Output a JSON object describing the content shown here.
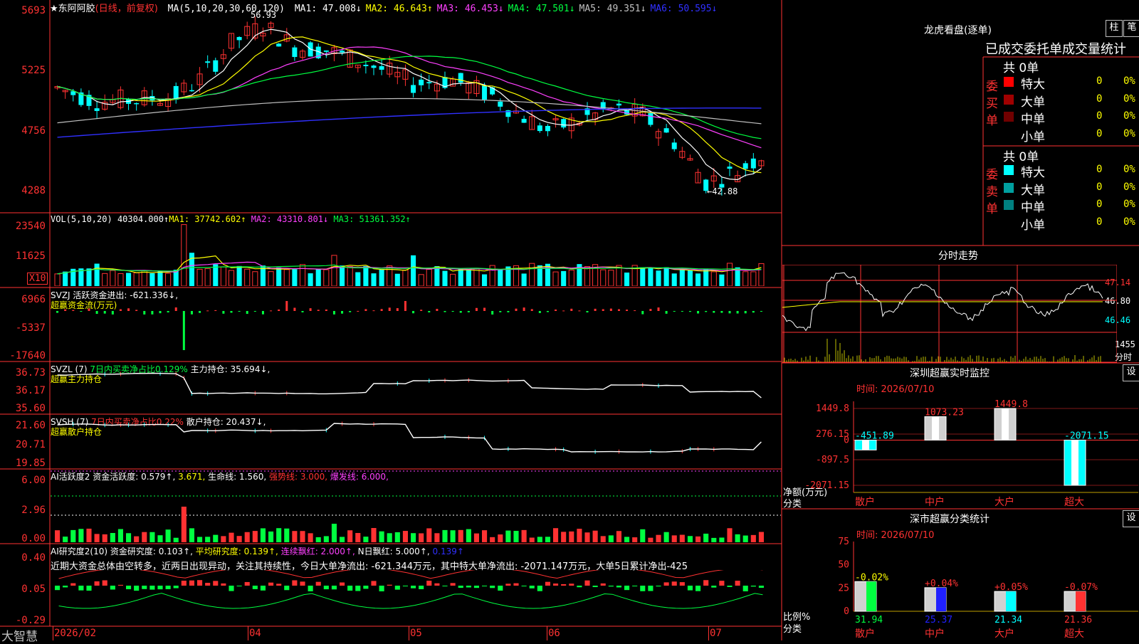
{
  "main": {
    "title": "★东阿阿胶",
    "period": "(日线，前复权)",
    "ma_header": "MA(5,10,20,30,60,120)",
    "ma": [
      {
        "label": "MA1:",
        "value": "47.008↓",
        "color": "#ffffff"
      },
      {
        "label": "MA2:",
        "value": "46.643↑",
        "color": "#ffff00"
      },
      {
        "label": "MA3:",
        "value": "46.453↓",
        "color": "#ff40ff"
      },
      {
        "label": "MA4:",
        "value": "47.501↓",
        "color": "#00ff40"
      },
      {
        "label": "MA5:",
        "value": "49.351↓",
        "color": "#c0c0c0"
      },
      {
        "label": "MA6:",
        "value": "50.595↓",
        "color": "#3030ff"
      }
    ],
    "y_labels": [
      "5693",
      "5225",
      "4756",
      "4288"
    ],
    "high_mark": "56.93",
    "low_mark": "←42.88"
  },
  "vol": {
    "header": "VOL(5,10,20)",
    "value": "40304.000↑",
    "ma1": "MA1: 37742.602↑",
    "ma2": "MA2: 43310.801↓",
    "ma3": "MA3: 51361.352↑",
    "y_labels": [
      "23540",
      "11625"
    ],
    "unit": "X10"
  },
  "svzj": {
    "header": "SVZJ",
    "text": "活跃资金进出: -621.336↓,",
    "sub": "超赢资金流(万元)",
    "y_labels": [
      "6966",
      "-5337",
      "-17640"
    ]
  },
  "svzl": {
    "header": "SVZL (7)",
    "text1": "7日内买卖净占比0.129%",
    "text2": "主力持仓: 35.694↓,",
    "sub": "超赢主力持仓",
    "y_labels": [
      "36.73",
      "36.17",
      "35.60"
    ]
  },
  "svsh": {
    "header": "SVSH (7)",
    "text1": "7日内买卖净占比0.22%",
    "text2": "散户持仓: 20.437↓,",
    "sub": "超赢散户持仓",
    "y_labels": [
      "21.60",
      "20.71",
      "19.85"
    ]
  },
  "ai1": {
    "header": "AI活跃度2",
    "t1": "资金活跃度: 0.579↑,",
    "t2": "3.671,",
    "t3": "生命线: 1.560,",
    "t4": "强势线: 3.000,",
    "t5": "爆发线: 6.000,",
    "y_labels": [
      "6.00",
      "2.96",
      "0.00"
    ]
  },
  "ai2": {
    "header": "AI研究度2(10)",
    "t1": "资金研究度: 0.103↑,",
    "t2": "平均研究度: 0.139↑,",
    "t3": "连续飘红: 2.000↑,",
    "t4": "N日飘红: 5.000↑,",
    "t5": "0.139↑",
    "note": "近期大资金总体由空转多，近两日出现异动，关注其持续性，今日大单净流出: -621.344万元，其中特大单净流出: -2071.147万元，大单5日累计净出-425",
    "y_labels": [
      "0.40",
      "0.05",
      "-0.29"
    ]
  },
  "xaxis": {
    "brand": "大智慧",
    "labels": [
      "2026/02",
      "04",
      "05",
      "06",
      "07"
    ]
  },
  "lhb": {
    "title": "龙虎看盘(逐单)",
    "btn1": "柱",
    "btn2": "笔",
    "subtitle": "已成交委托单成交量统计",
    "buy_label": "委买单",
    "sell_label": "委卖单",
    "buy_total": "共 0单",
    "sell_total": "共 0单",
    "buy_rows": [
      {
        "name": "特大",
        "val": "0",
        "pct": "0%",
        "color": "#ff0000"
      },
      {
        "name": "大单",
        "val": "0",
        "pct": "0%",
        "color": "#a00000"
      },
      {
        "name": "中单",
        "val": "0",
        "pct": "0%",
        "color": "#700000"
      },
      {
        "name": "小单",
        "val": "0",
        "pct": "0%",
        "color": "#000000"
      }
    ],
    "sell_rows": [
      {
        "name": "特大",
        "val": "0",
        "pct": "0%",
        "color": "#00ffff"
      },
      {
        "name": "大单",
        "val": "0",
        "pct": "0%",
        "color": "#00a0a0"
      },
      {
        "name": "中单",
        "val": "0",
        "pct": "0%",
        "color": "#008080"
      },
      {
        "name": "小单",
        "val": "0",
        "pct": "0%",
        "color": "#000000"
      }
    ]
  },
  "fenshi": {
    "title": "分时走势",
    "y_labels": [
      "47.14",
      "46.80",
      "46.46"
    ],
    "vol_label": "1455",
    "vol_unit": "分时"
  },
  "monitor": {
    "title": "深圳超赢实时监控",
    "btn": "设",
    "time": "时间: 2026/07/10",
    "y_labels": [
      "1449.8",
      "276.15",
      "0",
      "-897.5",
      "-2071.15"
    ],
    "axis_label1": "净额(万元)",
    "axis_label2": "分类",
    "categories": [
      "散户",
      "中户",
      "大户",
      "超大"
    ],
    "values": [
      -451.89,
      1073.23,
      1449.8,
      -2071.15
    ],
    "value_labels": [
      "-451.89",
      "1073.23",
      "1449.8",
      "-2071.15"
    ]
  },
  "classify": {
    "title": "深市超赢分类统计",
    "btn": "设",
    "time": "时间: 2026/07/10",
    "y_labels": [
      "75",
      "50",
      "25",
      "0"
    ],
    "axis_label1": "比例%",
    "axis_label2": "分类",
    "categories": [
      "散户",
      "中户",
      "大户",
      "超大"
    ],
    "values": [
      31.94,
      25.37,
      21.34,
      21.36
    ],
    "changes": [
      "-0.02%",
      "+0.04%",
      "+0.05%",
      "-0.07%"
    ],
    "value_labels": [
      "31.94",
      "25.37",
      "21.34",
      "21.36"
    ]
  },
  "colors": {
    "up": "#ff3232",
    "down": "#00ffff",
    "grid": "#ff3232"
  }
}
